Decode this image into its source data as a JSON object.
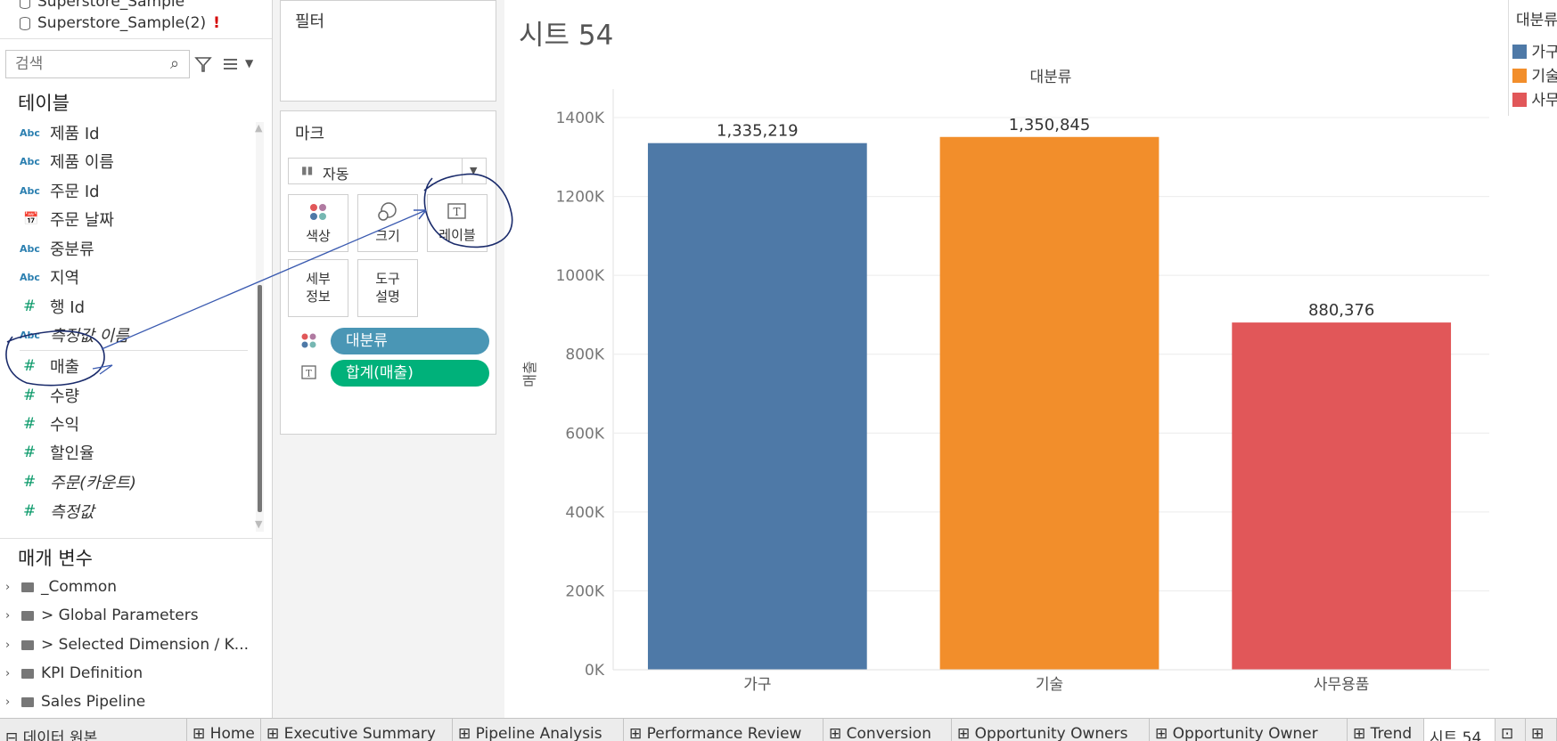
{
  "datasources": [
    {
      "name": "Superstore_Sample",
      "warning": ""
    },
    {
      "name": "Superstore_Sample(2)",
      "warning": "!"
    }
  ],
  "search": {
    "placeholder": "검색"
  },
  "tables_header": "테이블",
  "fields": [
    {
      "icon": "Abc",
      "label": "제품 Id",
      "italic": false
    },
    {
      "icon": "Abc",
      "label": "제품 이름",
      "italic": false
    },
    {
      "icon": "Abc",
      "label": "주문 Id",
      "italic": false
    },
    {
      "icon": "calendar-icon",
      "label": "주문 날짜",
      "italic": false
    },
    {
      "icon": "Abc",
      "label": "중분류",
      "italic": false
    },
    {
      "icon": "Abc",
      "label": "지역",
      "italic": false
    },
    {
      "icon": "#",
      "label": "행 Id",
      "italic": false
    },
    {
      "icon": "Abc",
      "label": "측정값 이름",
      "italic": true
    },
    {
      "icon": "#",
      "label": "매출",
      "italic": false
    },
    {
      "icon": "#",
      "label": "수량",
      "italic": false
    },
    {
      "icon": "#",
      "label": "수익",
      "italic": false
    },
    {
      "icon": "#",
      "label": "할인율",
      "italic": false
    },
    {
      "icon": "#",
      "label": "주문(카운트)",
      "italic": true
    },
    {
      "icon": "#",
      "label": "측정값",
      "italic": true
    }
  ],
  "params_header": "매개 변수",
  "param_folders": [
    "_Common",
    "> Global Parameters",
    "> Selected Dimension / K...",
    "KPI Definition",
    "Sales Pipeline"
  ],
  "filters_title": "필터",
  "marks": {
    "title": "마크",
    "type_label": "자동",
    "buttons": {
      "color": "색상",
      "size": "크기",
      "label": "레이블",
      "detail_1": "세부",
      "detail_2": "정보",
      "tooltip_1": "도구",
      "tooltip_2": "설명"
    },
    "pills": {
      "color_pill": "대분류",
      "label_pill": "합계(매출)"
    },
    "pill_colors": {
      "dimension": "#4a96b5",
      "measure": "#00b17a"
    }
  },
  "sheet_title": "시트 54",
  "legend": {
    "title": "대분류",
    "items": [
      "가구",
      "기술",
      "사무용품"
    ]
  },
  "chart_data": {
    "type": "bar",
    "title": "대분류",
    "categories": [
      "가구",
      "기술",
      "사무용품"
    ],
    "values": [
      1335219,
      1350845,
      880376
    ],
    "data_labels": [
      "1,335,219",
      "1,350,845",
      "880,376"
    ],
    "colors": [
      "#4e79a7",
      "#f28e2b",
      "#e15759"
    ],
    "ylabel": "매출",
    "yticks": [
      "0K",
      "200K",
      "400K",
      "600K",
      "800K",
      "1000K",
      "1200K",
      "1400K"
    ],
    "ylim": [
      0,
      1400000
    ],
    "grid": true,
    "legend_position": "top-right"
  },
  "tabs": [
    "데이터 원본",
    "Home",
    "Executive Summary",
    "Pipeline Analysis",
    "Performance Review",
    "Conversion",
    "Opportunity Owners",
    "Opportunity Owner",
    "Trend",
    "시트 54"
  ],
  "active_tab": "시트 54"
}
